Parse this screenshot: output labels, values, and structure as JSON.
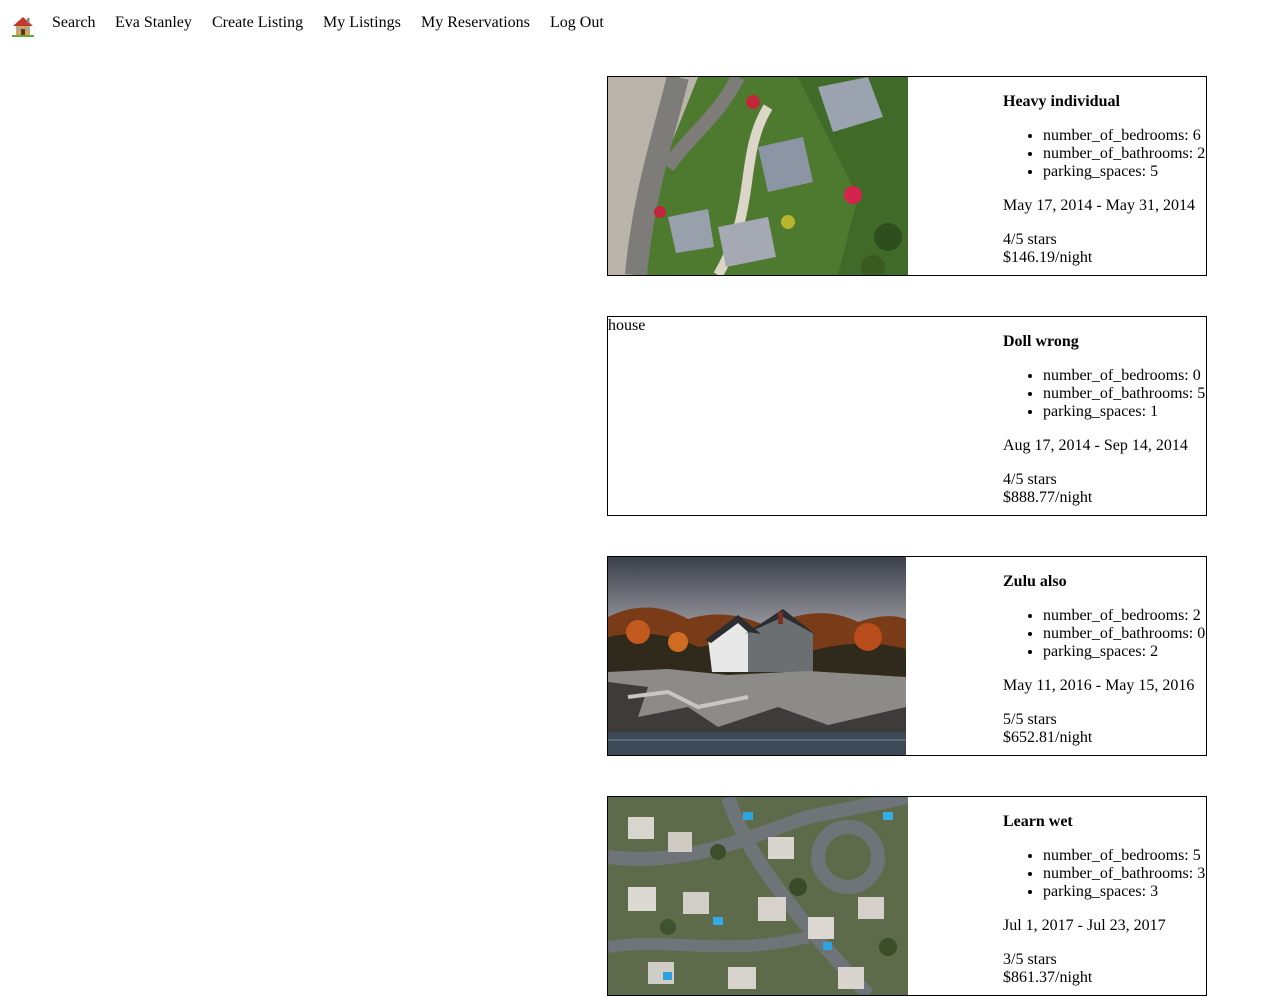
{
  "nav": {
    "home_icon": "house-emoji-icon",
    "links": [
      "Search",
      "Eva Stanley",
      "Create Listing",
      "My Listings",
      "My Reservations",
      "Log Out"
    ]
  },
  "listings": [
    {
      "title": "Heavy individual",
      "image_alt": "house",
      "image_shown": true,
      "features": [
        "number_of_bedrooms: 6",
        "number_of_bathrooms: 2",
        "parking_spaces: 5"
      ],
      "dates": "May 17, 2014 - May 31, 2014",
      "rating": "4/5 stars",
      "price": "$146.19/night"
    },
    {
      "title": "Doll wrong",
      "image_alt": "house",
      "image_shown": false,
      "features": [
        "number_of_bedrooms: 0",
        "number_of_bathrooms: 5",
        "parking_spaces: 1"
      ],
      "dates": "Aug 17, 2014 - Sep 14, 2014",
      "rating": "4/5 stars",
      "price": "$888.77/night"
    },
    {
      "title": "Zulu also",
      "image_alt": "house",
      "image_shown": true,
      "features": [
        "number_of_bedrooms: 2",
        "number_of_bathrooms: 0",
        "parking_spaces: 2"
      ],
      "dates": "May 11, 2016 - May 15, 2016",
      "rating": "5/5 stars",
      "price": "$652.81/night"
    },
    {
      "title": "Learn wet",
      "image_alt": "house",
      "image_shown": true,
      "features": [
        "number_of_bedrooms: 5",
        "number_of_bathrooms: 3",
        "parking_spaces: 3"
      ],
      "dates": "Jul 1, 2017 - Jul 23, 2017",
      "rating": "3/5 stars",
      "price": "$861.37/night"
    }
  ]
}
